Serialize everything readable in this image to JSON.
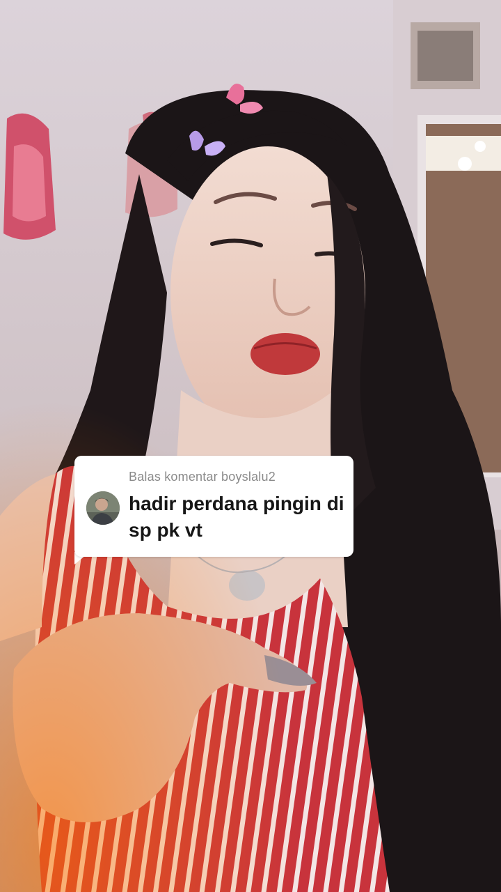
{
  "reply": {
    "header": "Balas komentar boyslalu2",
    "text": "hadir perdana pingin di sp pk vt",
    "avatar_icon": "user-avatar-icon"
  },
  "colors": {
    "card_bg": "#ffffff",
    "header_text": "#8a8a8a",
    "body_text": "#161616",
    "dress_red": "#c8333c"
  }
}
